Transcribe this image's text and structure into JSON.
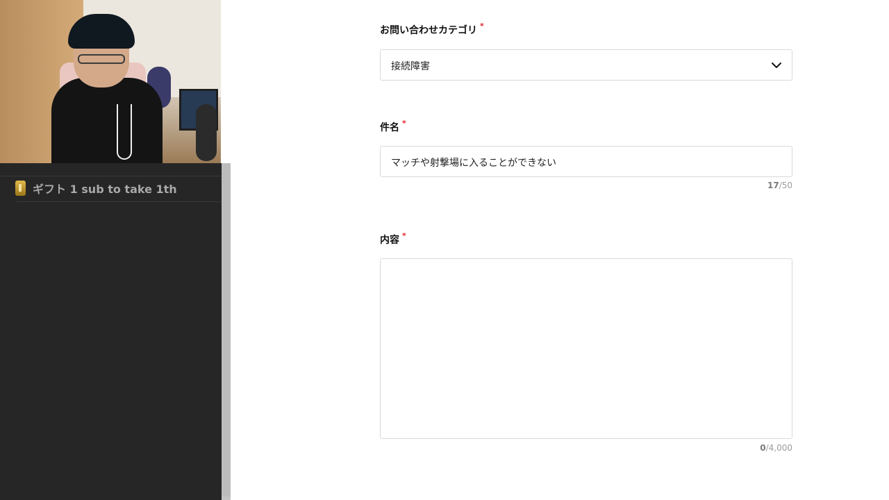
{
  "overlay": {
    "gift_text": "ギフト 1 sub to take 1th"
  },
  "form": {
    "category": {
      "label": "お問い合わせカテゴリ",
      "required_mark": "*",
      "selected": "接続障害"
    },
    "subject": {
      "label": "件名",
      "required_mark": "*",
      "value": "マッチや射撃場に入ることができない",
      "count": "17",
      "max": "/50"
    },
    "content": {
      "label": "内容",
      "required_mark": "*",
      "value": "",
      "count": "0",
      "max": "/4,000"
    }
  },
  "colors": {
    "required": "#e0242c",
    "panel_bg": "#262626",
    "gift_icon": "#e0b84a"
  }
}
